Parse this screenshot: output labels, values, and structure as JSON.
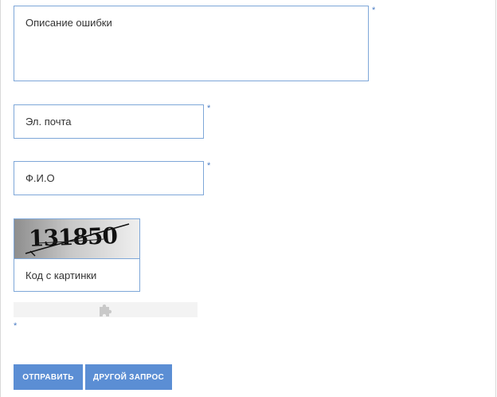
{
  "form": {
    "description_placeholder": "Описание ошибки",
    "email_placeholder": "Эл. почта",
    "name_placeholder": "Ф.И.О",
    "required_mark": "*",
    "captcha": {
      "code": "131850",
      "input_placeholder": "Код с картинки"
    },
    "widget": {
      "icon": "puzzle-icon"
    }
  },
  "buttons": {
    "submit_label": "ОТПРАВИТЬ",
    "other_request_label": "ДРУГОЙ ЗАПРОС"
  },
  "colors": {
    "field_border": "#7ea7d8",
    "button_bg": "#5b8ed4",
    "required_mark": "#4a7cc4"
  }
}
